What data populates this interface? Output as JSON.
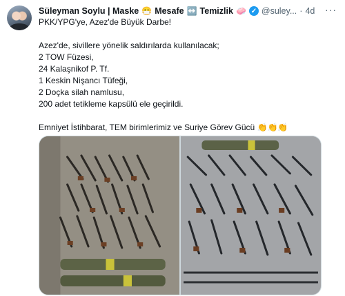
{
  "tweet": {
    "author_name": "Süleyman Soylu | Maske",
    "name_emoji_1": "😷",
    "name_mid": "Mesafe",
    "name_emoji_2": "↔️",
    "name_end": "Temizlik",
    "name_emoji_3": "🧼",
    "handle": "@suley...",
    "separator": "·",
    "time": "4d",
    "more_label": "···",
    "lines": [
      "PKK/YPG'ye, Azez'de Büyük Darbe!",
      "",
      "Azez'de, sivillere yönelik saldırılarda kullanılacak;",
      "2 TOW Füzesi,",
      "24 Kalaşnikof P. Tf.",
      "1 Keskin Nişancı Tüfeği,",
      "2 Doçka silah namlusu,",
      "200 adet tetikleme kapsülü ele geçirildi.",
      "",
      "Emniyet İstihbarat, TEM birimlerimiz ve Suriye Görev Gücü 👏👏👏"
    ]
  },
  "icons": {
    "verified": "verified-badge-icon",
    "more": "more-options-icon"
  },
  "colors": {
    "accent": "#1d9bf0",
    "text": "#0f1419",
    "muted": "#536471"
  }
}
